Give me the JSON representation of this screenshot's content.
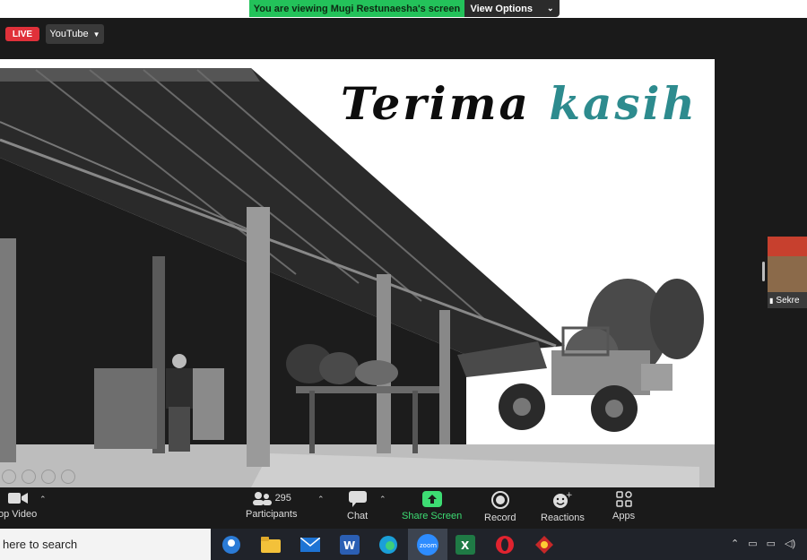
{
  "banner": {
    "message": "You are viewing Mugi Restunaesha's screen",
    "options_label": "View Options"
  },
  "live": {
    "badge": "LIVE",
    "platform": "YouTube"
  },
  "slide": {
    "title_word1": "Terima",
    "title_word2": "kasih"
  },
  "side_panel": {
    "name": "Sekre"
  },
  "toolbar": {
    "video_label": "op Video",
    "participants_label": "Participants",
    "participants_count": "295",
    "chat_label": "Chat",
    "share_label": "Share Screen",
    "record_label": "Record",
    "reactions_label": "Reactions",
    "apps_label": "Apps"
  },
  "taskbar": {
    "search_placeholder": "here to search"
  },
  "colors": {
    "share_green": "#23c25a",
    "live_red": "#e0313a",
    "title_teal": "#2d8b8e"
  }
}
